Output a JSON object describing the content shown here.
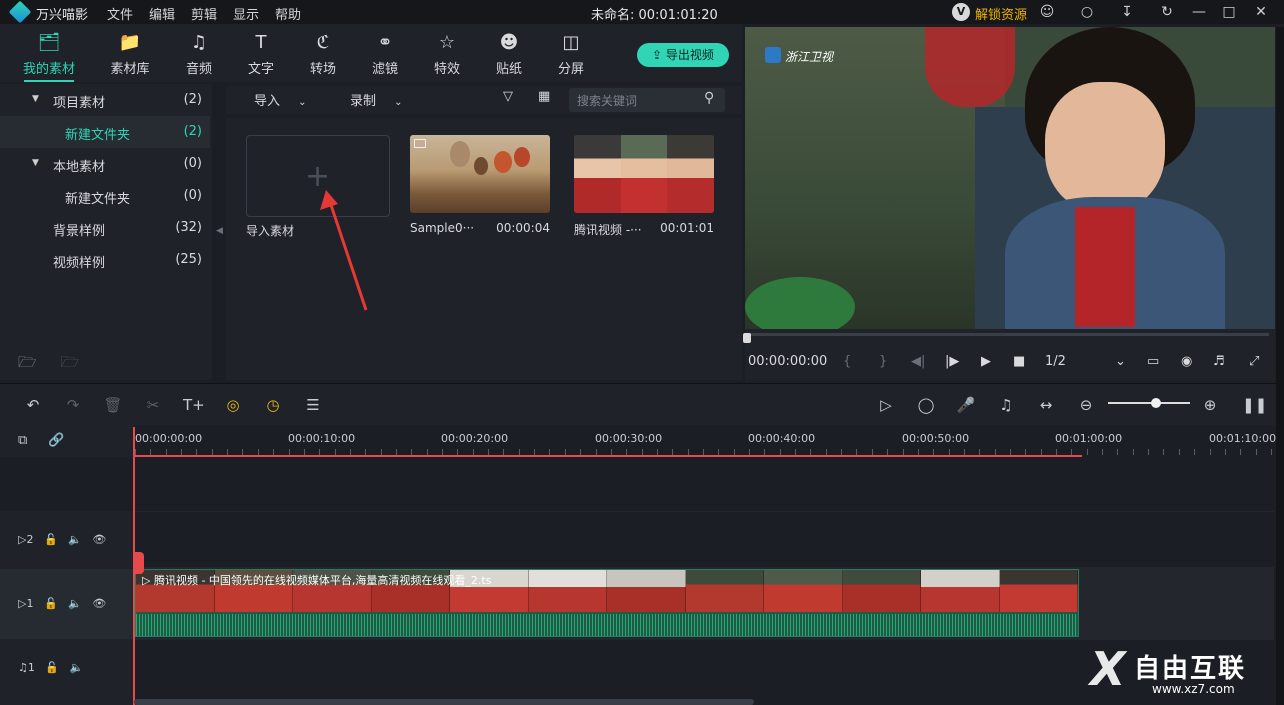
{
  "app": {
    "name": "万兴喵影",
    "menus": [
      "文件",
      "编辑",
      "剪辑",
      "显示",
      "帮助"
    ],
    "title": "未命名: 00:01:01:20",
    "unlock": "解锁资源"
  },
  "tabs": [
    {
      "label": "我的素材",
      "icon": "media-folder-icon"
    },
    {
      "label": "素材库",
      "icon": "library-icon"
    },
    {
      "label": "音频",
      "icon": "music-note-icon"
    },
    {
      "label": "文字",
      "icon": "text-icon"
    },
    {
      "label": "转场",
      "icon": "transition-icon"
    },
    {
      "label": "滤镜",
      "icon": "filter-icon"
    },
    {
      "label": "特效",
      "icon": "effects-icon"
    },
    {
      "label": "贴纸",
      "icon": "sticker-icon"
    },
    {
      "label": "分屏",
      "icon": "split-screen-icon"
    }
  ],
  "export_label": "导出视频",
  "tree": [
    {
      "name": "项目素材",
      "count": "(2)"
    },
    {
      "name": "新建文件夹",
      "count": "(2)"
    },
    {
      "name": "本地素材",
      "count": "(0)"
    },
    {
      "name": "新建文件夹",
      "count": "(0)"
    },
    {
      "name": "背景样例",
      "count": "(32)"
    },
    {
      "name": "视频样例",
      "count": "(25)"
    }
  ],
  "mediabar": {
    "import": "导入",
    "record": "录制",
    "search_placeholder": "搜索关键词"
  },
  "media": {
    "import_label": "导入素材",
    "cards": [
      {
        "name": "Sample0···",
        "duration": "00:00:04"
      },
      {
        "name": "腾讯视频 -···",
        "duration": "00:01:01"
      }
    ]
  },
  "preview": {
    "channel": "浙江卫视",
    "time": "00:00:00:00",
    "ratio": "1/2"
  },
  "timeline": {
    "ruler": [
      "00:00:00:00",
      "00:00:10:00",
      "00:00:20:00",
      "00:00:30:00",
      "00:00:40:00",
      "00:00:50:00",
      "00:01:00:00",
      "00:01:10:00"
    ],
    "tracks": [
      "2",
      "1",
      "1"
    ],
    "clip_title": "腾讯视频 - 中国领先的在线视频媒体平台,海量高清视频在线观看_2.ts"
  },
  "watermark": {
    "text": "自由互联",
    "url": "www.xz7.com"
  }
}
